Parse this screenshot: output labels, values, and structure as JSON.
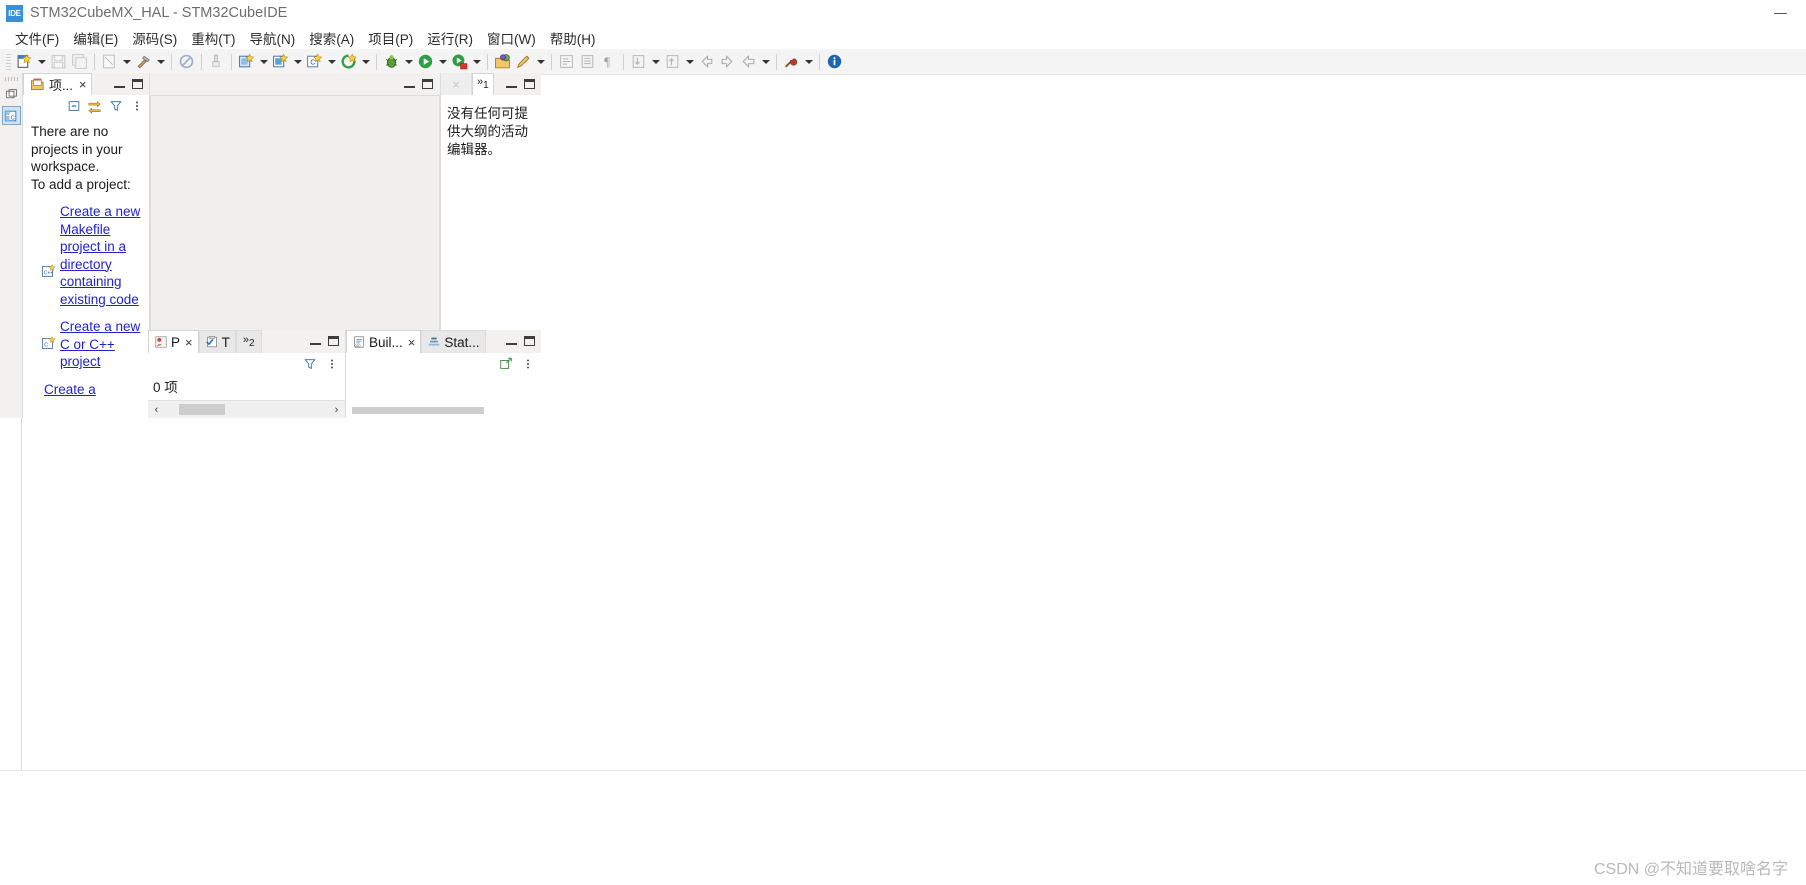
{
  "window": {
    "app_icon_label": "IDE",
    "title": "STM32CubeMX_HAL - STM32CubeIDE",
    "minimize_label": "–"
  },
  "menubar": {
    "items": [
      {
        "label": "文件(F)",
        "name": "menu-file"
      },
      {
        "label": "编辑(E)",
        "name": "menu-edit"
      },
      {
        "label": "源码(S)",
        "name": "menu-source"
      },
      {
        "label": "重构(T)",
        "name": "menu-refactor"
      },
      {
        "label": "导航(N)",
        "name": "menu-navigate"
      },
      {
        "label": "搜索(A)",
        "name": "menu-search"
      },
      {
        "label": "项目(P)",
        "name": "menu-project"
      },
      {
        "label": "运行(R)",
        "name": "menu-run"
      },
      {
        "label": "窗口(W)",
        "name": "menu-window"
      },
      {
        "label": "帮助(H)",
        "name": "menu-help"
      }
    ]
  },
  "toolbar": {
    "groups": [
      [
        "new-wizard-icon",
        "dropdown",
        "save-icon",
        "save-all-icon"
      ],
      [
        "new-c-file-icon",
        "dropdown",
        "build-hammer-icon",
        "dropdown"
      ],
      [
        "no-build-icon"
      ],
      [
        "clean-icon"
      ],
      [
        "new-stm32-project-icon",
        "dropdown",
        "new-stm32-config-icon",
        "dropdown",
        "new-c-project-icon",
        "dropdown",
        "refresh-icon",
        "dropdown"
      ],
      [
        "debug-bug-icon",
        "dropdown",
        "run-icon",
        "dropdown",
        "run-config-icon",
        "dropdown"
      ],
      [
        "open-perspective-icon",
        "highlight-pen-icon",
        "dropdown"
      ],
      [
        "toggle-block-icon",
        "show-whitespace-icon",
        "pilcrow-icon"
      ],
      [
        "next-annotation-icon",
        "dropdown",
        "previous-annotation-icon",
        "dropdown",
        "back-icon",
        "forward-icon",
        "back-arrow-icon",
        "dropdown"
      ],
      [
        "external-tools-icon"
      ],
      [
        "info-icon"
      ]
    ]
  },
  "fastbar": {
    "restore_label": "restore-view-icon",
    "perspective_label": "cpp-perspective-icon"
  },
  "project_explorer": {
    "tab_label": "项...",
    "tab_close": "×",
    "toolbar_icons": [
      "collapse-all-icon",
      "link-with-editor-icon",
      "view-filter-icon",
      "view-menu-icon"
    ],
    "empty_text_line1": "There are no",
    "empty_text_line2": "projects in your",
    "empty_text_line3": "workspace.",
    "empty_text_line4": "To add a project:",
    "links": [
      "Create a new Makefile project in a directory containing existing code",
      "Create a new C or C++ project",
      "Create a"
    ],
    "minimize": "minimize-view-button",
    "maximize": "maximize-view-button"
  },
  "editor_area": {
    "minimize": "minimize-editor-button",
    "maximize": "maximize-editor-button"
  },
  "outline_view": {
    "ghost_tab_close": "×",
    "chevron_label": "»",
    "chevron_count": "1",
    "message_line1": "没有任何可提",
    "message_line2": "供大纲的活动",
    "message_line3": "编辑器。",
    "minimize": "minimize-outline-button",
    "maximize": "maximize-outline-button"
  },
  "problems_panel": {
    "tab_label": "P",
    "tab_close": "×",
    "tasks_tab_label": "T",
    "chevron_label": "»",
    "chevron_count": "2",
    "count_text": "0 项",
    "filter_icon": "view-filter-icon",
    "menu_icon": "view-menu-icon",
    "scroll_left": "‹",
    "scroll_right": "›"
  },
  "build_panel": {
    "tab_label": "Buil...",
    "tab_close": "×",
    "stat_tab_label": "Stat...",
    "toolbar_icons": [
      "open-console-icon",
      "view-menu-icon"
    ]
  },
  "watermark": {
    "text": "CSDN @不知道要取啥名字"
  },
  "colors": {
    "accent_blue": "#3b8fd4",
    "link_blue": "#2222cc",
    "panel_bg": "#f2f1f0",
    "toolbar_bg": "#f4f4f4",
    "watermark_grey": "#b9b9b9"
  }
}
